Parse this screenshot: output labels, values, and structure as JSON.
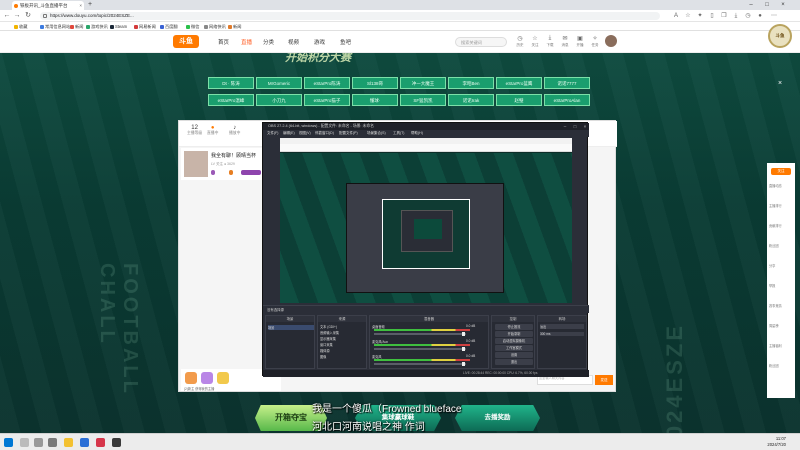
{
  "browser": {
    "tab_title": "铁板开讯_斗鱼直播平台",
    "url": "https://www.douyu.com/topic/2024ESZE...",
    "bookmarks": [
      "收藏",
      "常用信息网站",
      "新闻",
      "游戏快讯",
      "Steam",
      "网易新闻",
      "百度翻",
      "微信",
      "网络快讯",
      "新闻"
    ]
  },
  "site": {
    "logo": "斗鱼",
    "nav": [
      "首页",
      "直播",
      "分类",
      "视频",
      "游戏",
      "鱼吧"
    ],
    "search_placeholder": "搜索关键词",
    "header_icons": [
      {
        "label": "历史",
        "icon": "history-icon"
      },
      {
        "label": "关注",
        "icon": "star-icon"
      },
      {
        "label": "下载",
        "icon": "download-icon"
      },
      {
        "label": "消息",
        "icon": "message-icon"
      },
      {
        "label": "开播",
        "icon": "camera-icon"
      },
      {
        "label": "任务",
        "icon": "task-icon"
      }
    ]
  },
  "event": {
    "banner_title": "开始积分大赛",
    "streams_row1": [
      "Dt · 陈涛",
      "MrGomeric",
      "eStarPro陈涛",
      "Sl138哥",
      "冲一大魔王",
      "李昭Ben",
      "eStarPro蓝鹰",
      "诺诺7777"
    ],
    "streams_row2": [
      "eStarPro温峰",
      "小刀九",
      "eStarPro猫子",
      "懂球·",
      "SF猛凯凯",
      "诺诺Irak",
      "赵璧",
      "eStarProAlan"
    ],
    "watermark_left": "FOOTBALL CHALL",
    "watermark_right": "2024ESZE",
    "float_logo": "斗鱼"
  },
  "room": {
    "stats": [
      {
        "value": "12",
        "label": "主播等级"
      },
      {
        "value": "●",
        "label": "直播中"
      },
      {
        "value": "♪",
        "label": "播放中"
      }
    ],
    "anchor_name": "我全有聊！顾晴当杯",
    "anchor_sub": "LV 关注 ● 3629",
    "follow_btn": "关注",
    "sidebar_lines": [
      "直播动态",
      "主播排行",
      "贡献排行",
      "粉丝团",
      "分享",
      "举报",
      "赛事竞猜",
      "周星榜",
      "主播福利",
      "粉丝团"
    ],
    "gift_label": "(2)新主 获得我的主播",
    "chat_placeholder": "这里输入聊天内容",
    "send_btn": "发送"
  },
  "obs": {
    "title": "OBS 27.2.4 (64-bit, windows) - 配置文件: 未命名 - 场景: 未命名",
    "menu": [
      "文件(F)",
      "编辑(E)",
      "视图(V)",
      "停靠窗口(D)",
      "配置文件(P)",
      "场景集合(S)",
      "工具(T)",
      "帮助(H)"
    ],
    "no_source": "没有选择源",
    "scenes_header": "场景",
    "scenes": [
      "场景"
    ],
    "sources_header": "来源",
    "sources": [
      "文本 (GDI+)",
      "音频输入采集",
      "显示器采集",
      "窗口采集",
      "媒体源",
      "图像"
    ],
    "mixer_header": "混音器",
    "mixer": [
      {
        "name": "桌面音频",
        "db": "0.0 dB"
      },
      {
        "name": "麦克风/Aux",
        "db": "0.0 dB"
      },
      {
        "name": "麦克风",
        "db": "0.0 dB"
      }
    ],
    "transition_header": "转场",
    "transition_name": "淡出",
    "transition_duration": "300 ms",
    "controls_header": "控制",
    "controls": [
      "停止推流",
      "开始录制",
      "启动虚拟摄像机",
      "工作室模式",
      "设置",
      "退出"
    ],
    "status": "LIVE: 00:28:44   REC: 00:00:00   CPU: 6.7%, 60.00 fps"
  },
  "bottom": {
    "btn_a": "开箱夺宝",
    "btn_b": "集球赢球鞋",
    "btn_c": "去播奖励",
    "subtitle1": "我是一个傻瓜（Frowned blueface",
    "subtitle2": "河北口河南说唱之神 作词"
  },
  "clock": {
    "time": "11:07",
    "date": "2024/7/20"
  }
}
